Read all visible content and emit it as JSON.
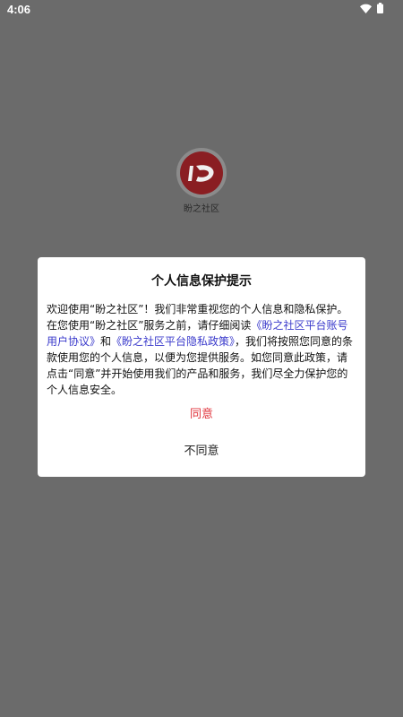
{
  "status_bar": {
    "time": "4:06",
    "wifi_icon": "wifi-icon",
    "battery_icon": "battery-icon"
  },
  "app": {
    "name": "盼之社区",
    "logo_color": "#8a1e22"
  },
  "dialog": {
    "title": "个人信息保护提示",
    "body": {
      "p1": "欢迎使用“盼之社区”！我们非常重视您的个人信息和隐私保护。在您使用“盼之社区”服务之前，请仔细阅读",
      "link1": "《盼之社区平台账号用户协议》",
      "p2": "和",
      "link2": "《盼之社区平台隐私政策》",
      "p3": "，我们将按照您同意的条款使用您的个人信息，以便为您提供服务。如您同意此政策，请点击“同意”并开始使用我们的产品和服务，我们尽全力保护您的个人信息安全。"
    },
    "agree_label": "同意",
    "disagree_label": "不同意",
    "agree_color": "#e0353d",
    "link_color": "#3a3acb"
  }
}
